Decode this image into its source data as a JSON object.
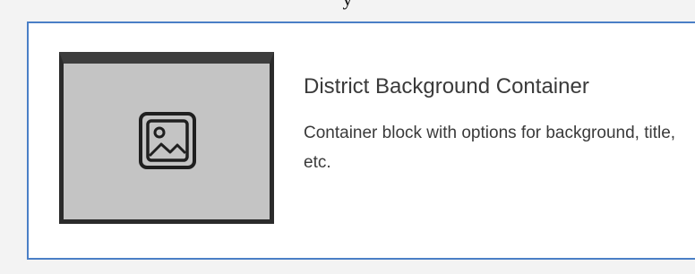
{
  "top_text": "y",
  "card": {
    "title": "District Background Container",
    "description": "Container block with options for background, title, etc.",
    "thumbnail_icon": "image-icon",
    "border_color": "#4a7fc6",
    "thumbnail_color": "#c4c4c4"
  }
}
